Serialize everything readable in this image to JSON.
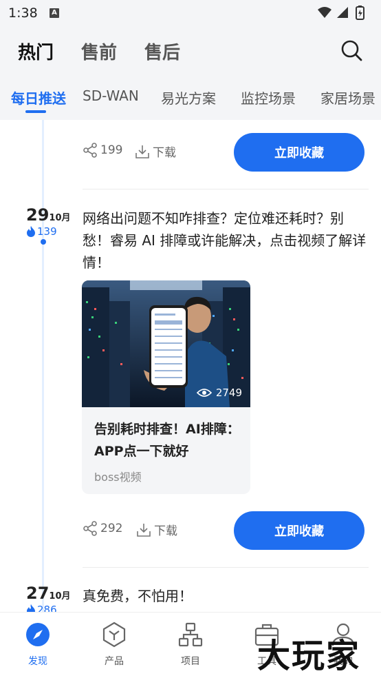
{
  "status_bar": {
    "time": "1:38",
    "notification_glyph": "A"
  },
  "top_tabs": [
    {
      "label": "热门",
      "active": true
    },
    {
      "label": "售前",
      "active": false
    },
    {
      "label": "售后",
      "active": false
    }
  ],
  "sub_tabs": [
    {
      "label": "每日推送",
      "active": true
    },
    {
      "label": "SD-WAN",
      "active": false
    },
    {
      "label": "易光方案",
      "active": false
    },
    {
      "label": "监控场景",
      "active": false
    },
    {
      "label": "家居场景",
      "active": false
    }
  ],
  "feed": {
    "first_actions": {
      "shares": "199",
      "download_label": "下载",
      "collect_label": "立即收藏"
    },
    "post_1": {
      "day": "29",
      "month": "10月",
      "heat": "139",
      "text": "网络出问题不知咋排查？定位难还耗时？别愁！睿易 AI 排障或许能解决，点击视频了解详情！",
      "card": {
        "views": "2749",
        "title": "告别耗时排查！AI排障：APP点一下就好",
        "source": "boss视频"
      },
      "actions": {
        "shares": "292",
        "download_label": "下载",
        "collect_label": "立即收藏"
      }
    },
    "post_2": {
      "day": "27",
      "month": "10月",
      "heat": "286",
      "text": "真免费，不怕用！"
    }
  },
  "bottom_nav": [
    {
      "label": "发现",
      "icon": "compass-icon",
      "active": true
    },
    {
      "label": "产品",
      "icon": "product-icon",
      "active": false
    },
    {
      "label": "项目",
      "icon": "project-icon",
      "active": false
    },
    {
      "label": "工具",
      "icon": "toolbox-icon",
      "active": false
    },
    {
      "label": "我的",
      "icon": "user-icon",
      "active": false
    }
  ],
  "watermark": "大玩家",
  "colors": {
    "accent": "#1f6ef0",
    "background": "#f4f5f7"
  }
}
